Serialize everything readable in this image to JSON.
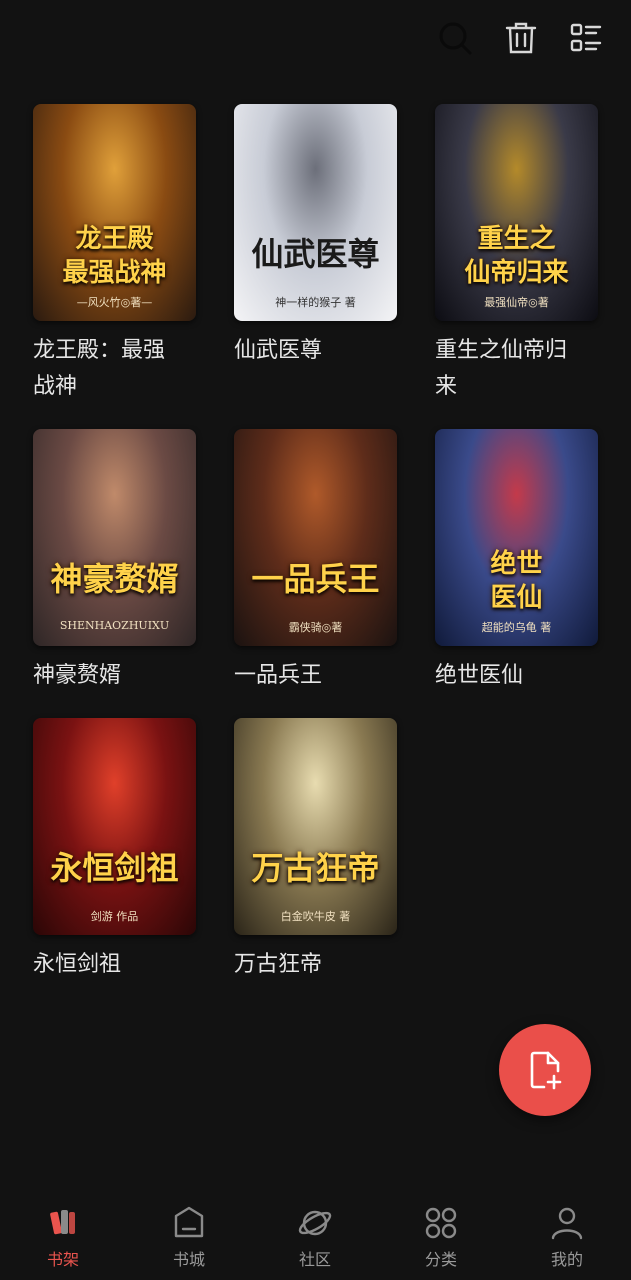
{
  "toolbar": {
    "search_icon": "search-icon",
    "delete_icon": "trash-icon",
    "manage_icon": "list-icon"
  },
  "books": [
    {
      "title": "龙王殿：最强战神",
      "cover_text": "龙王殿\n最强战神",
      "cover_author": "—风火竹◎著—",
      "palette": [
        "#2a1a10",
        "#8a4b12",
        "#e0a03a"
      ]
    },
    {
      "title": "仙武医尊",
      "cover_text": "仙武医尊",
      "cover_author": "神一样的猴子 著",
      "palette": [
        "#f4f4f6",
        "#c8ccd6",
        "#6c6f7a"
      ]
    },
    {
      "title": "重生之仙帝归来",
      "cover_text": "重生之\n仙帝归来",
      "cover_author": "最强仙帝◎著",
      "palette": [
        "#0c0c12",
        "#3a3a48",
        "#b48a2a"
      ]
    },
    {
      "title": "神豪赘婿",
      "cover_text": "神豪赘婿",
      "cover_author": "SHENHAOZHUIXU",
      "palette": [
        "#2e2626",
        "#6b4a44",
        "#c08a6a"
      ]
    },
    {
      "title": "一品兵王",
      "cover_text": "一品兵王",
      "cover_author": "霸侠骑◎著",
      "palette": [
        "#1a1210",
        "#5e2c1a",
        "#b05a2a"
      ]
    },
    {
      "title": "绝世医仙",
      "cover_text": "绝世\n医仙",
      "cover_author": "超能的乌龟 著",
      "palette": [
        "#101a3a",
        "#3a4a8a",
        "#c43a4a"
      ]
    },
    {
      "title": "永恒剑祖",
      "cover_text": "永恒剑祖",
      "cover_author": "剑游 作品",
      "palette": [
        "#2a0606",
        "#7a1212",
        "#e0402a"
      ]
    },
    {
      "title": "万古狂帝",
      "cover_text": "万古狂帝",
      "cover_author": "白金吹牛皮 著",
      "palette": [
        "#2a2418",
        "#8a7a52",
        "#e8dcb0"
      ]
    }
  ],
  "fab": {
    "icon": "add-file-icon"
  },
  "tabs": [
    {
      "label": "书架",
      "icon": "bookshelf-icon",
      "active": true
    },
    {
      "label": "书城",
      "icon": "store-icon",
      "active": false
    },
    {
      "label": "社区",
      "icon": "planet-icon",
      "active": false
    },
    {
      "label": "分类",
      "icon": "category-icon",
      "active": false
    },
    {
      "label": "我的",
      "icon": "profile-icon",
      "active": false
    }
  ],
  "colors": {
    "background": "#121212",
    "accent": "#e9544e",
    "fab": "#ea4f4a"
  }
}
